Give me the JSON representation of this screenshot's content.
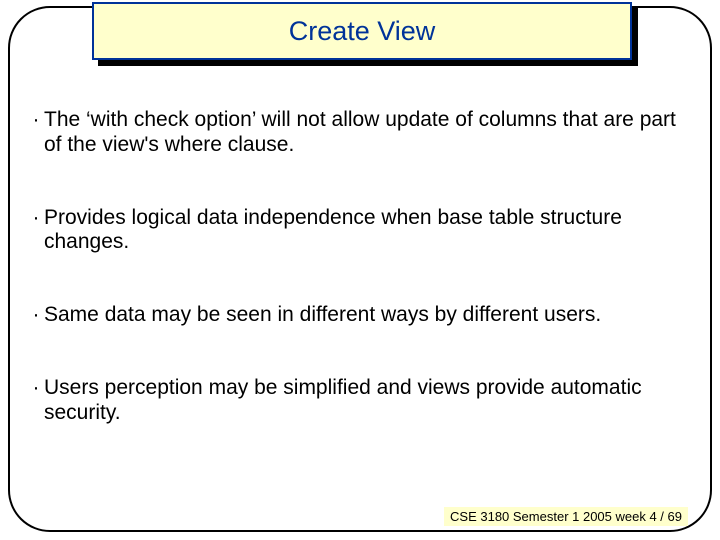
{
  "title": "Create View",
  "bullets": [
    "The ‘with check option’ will not allow update of columns that are part of the view's where clause.",
    "Provides logical data independence when base table structure changes.",
    "Same data may be seen in different ways by different users.",
    "Users perception may be simplified and  views provide automatic security."
  ],
  "footer": "CSE 3180 Semester 1 2005  week 4 / 69"
}
